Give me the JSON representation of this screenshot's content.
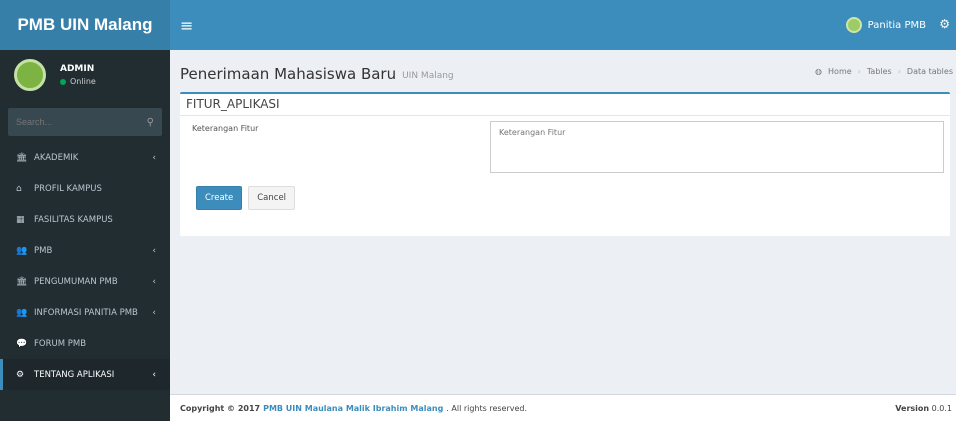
{
  "brand": "PMB UIN Malang",
  "topbar": {
    "menu_icon": "≡",
    "user_name": "Panitia PMB"
  },
  "sidebar": {
    "user": {
      "name": "ADMIN",
      "status": "Online"
    },
    "search_placeholder": "Search...",
    "items": [
      {
        "label": "AKADEMIK",
        "icon": "institution-icon",
        "glyph": "🏛",
        "chevron": true
      },
      {
        "label": "PROFIL KAMPUS",
        "icon": "home-icon",
        "glyph": "⌂",
        "chevron": false
      },
      {
        "label": "FASILITAS KAMPUS",
        "icon": "building-icon",
        "glyph": "▦",
        "chevron": false
      },
      {
        "label": "PMB",
        "icon": "user-plus-icon",
        "glyph": "👥",
        "chevron": true
      },
      {
        "label": "PENGUMUMAN PMB",
        "icon": "institution-icon",
        "glyph": "🏛",
        "chevron": true
      },
      {
        "label": "INFORMASI PANITIA PMB",
        "icon": "users-icon",
        "glyph": "👥",
        "chevron": true
      },
      {
        "label": "FORUM PMB",
        "icon": "comments-icon",
        "glyph": "💬",
        "chevron": false
      },
      {
        "label": "TENTANG APLIKASI",
        "icon": "gear-icon",
        "glyph": "⚙",
        "chevron": true
      }
    ],
    "active_index": 7
  },
  "content": {
    "title": "Penerimaan Mahasiswa Baru",
    "subtitle": "UIN Malang",
    "breadcrumb": [
      "Home",
      "Tables",
      "Data tables"
    ]
  },
  "form": {
    "box_title": "FITUR_APLIKASI",
    "field_label": "Keterangan Fitur",
    "field_placeholder": "Keterangan Fitur",
    "create_label": "Create",
    "cancel_label": "Cancel"
  },
  "footer": {
    "prefix": "Copyright © 2017",
    "link": "PMB UIN Maulana Malik Ibrahim Malang",
    "suffix": ". All rights reserved.",
    "version_label": "Version",
    "version_value": "0.0.1"
  },
  "colors": {
    "primary": "#3c8dbc",
    "logo_bg": "#367fa9",
    "sidebar_bg": "#222d32",
    "content_bg": "#ecf0f5"
  }
}
